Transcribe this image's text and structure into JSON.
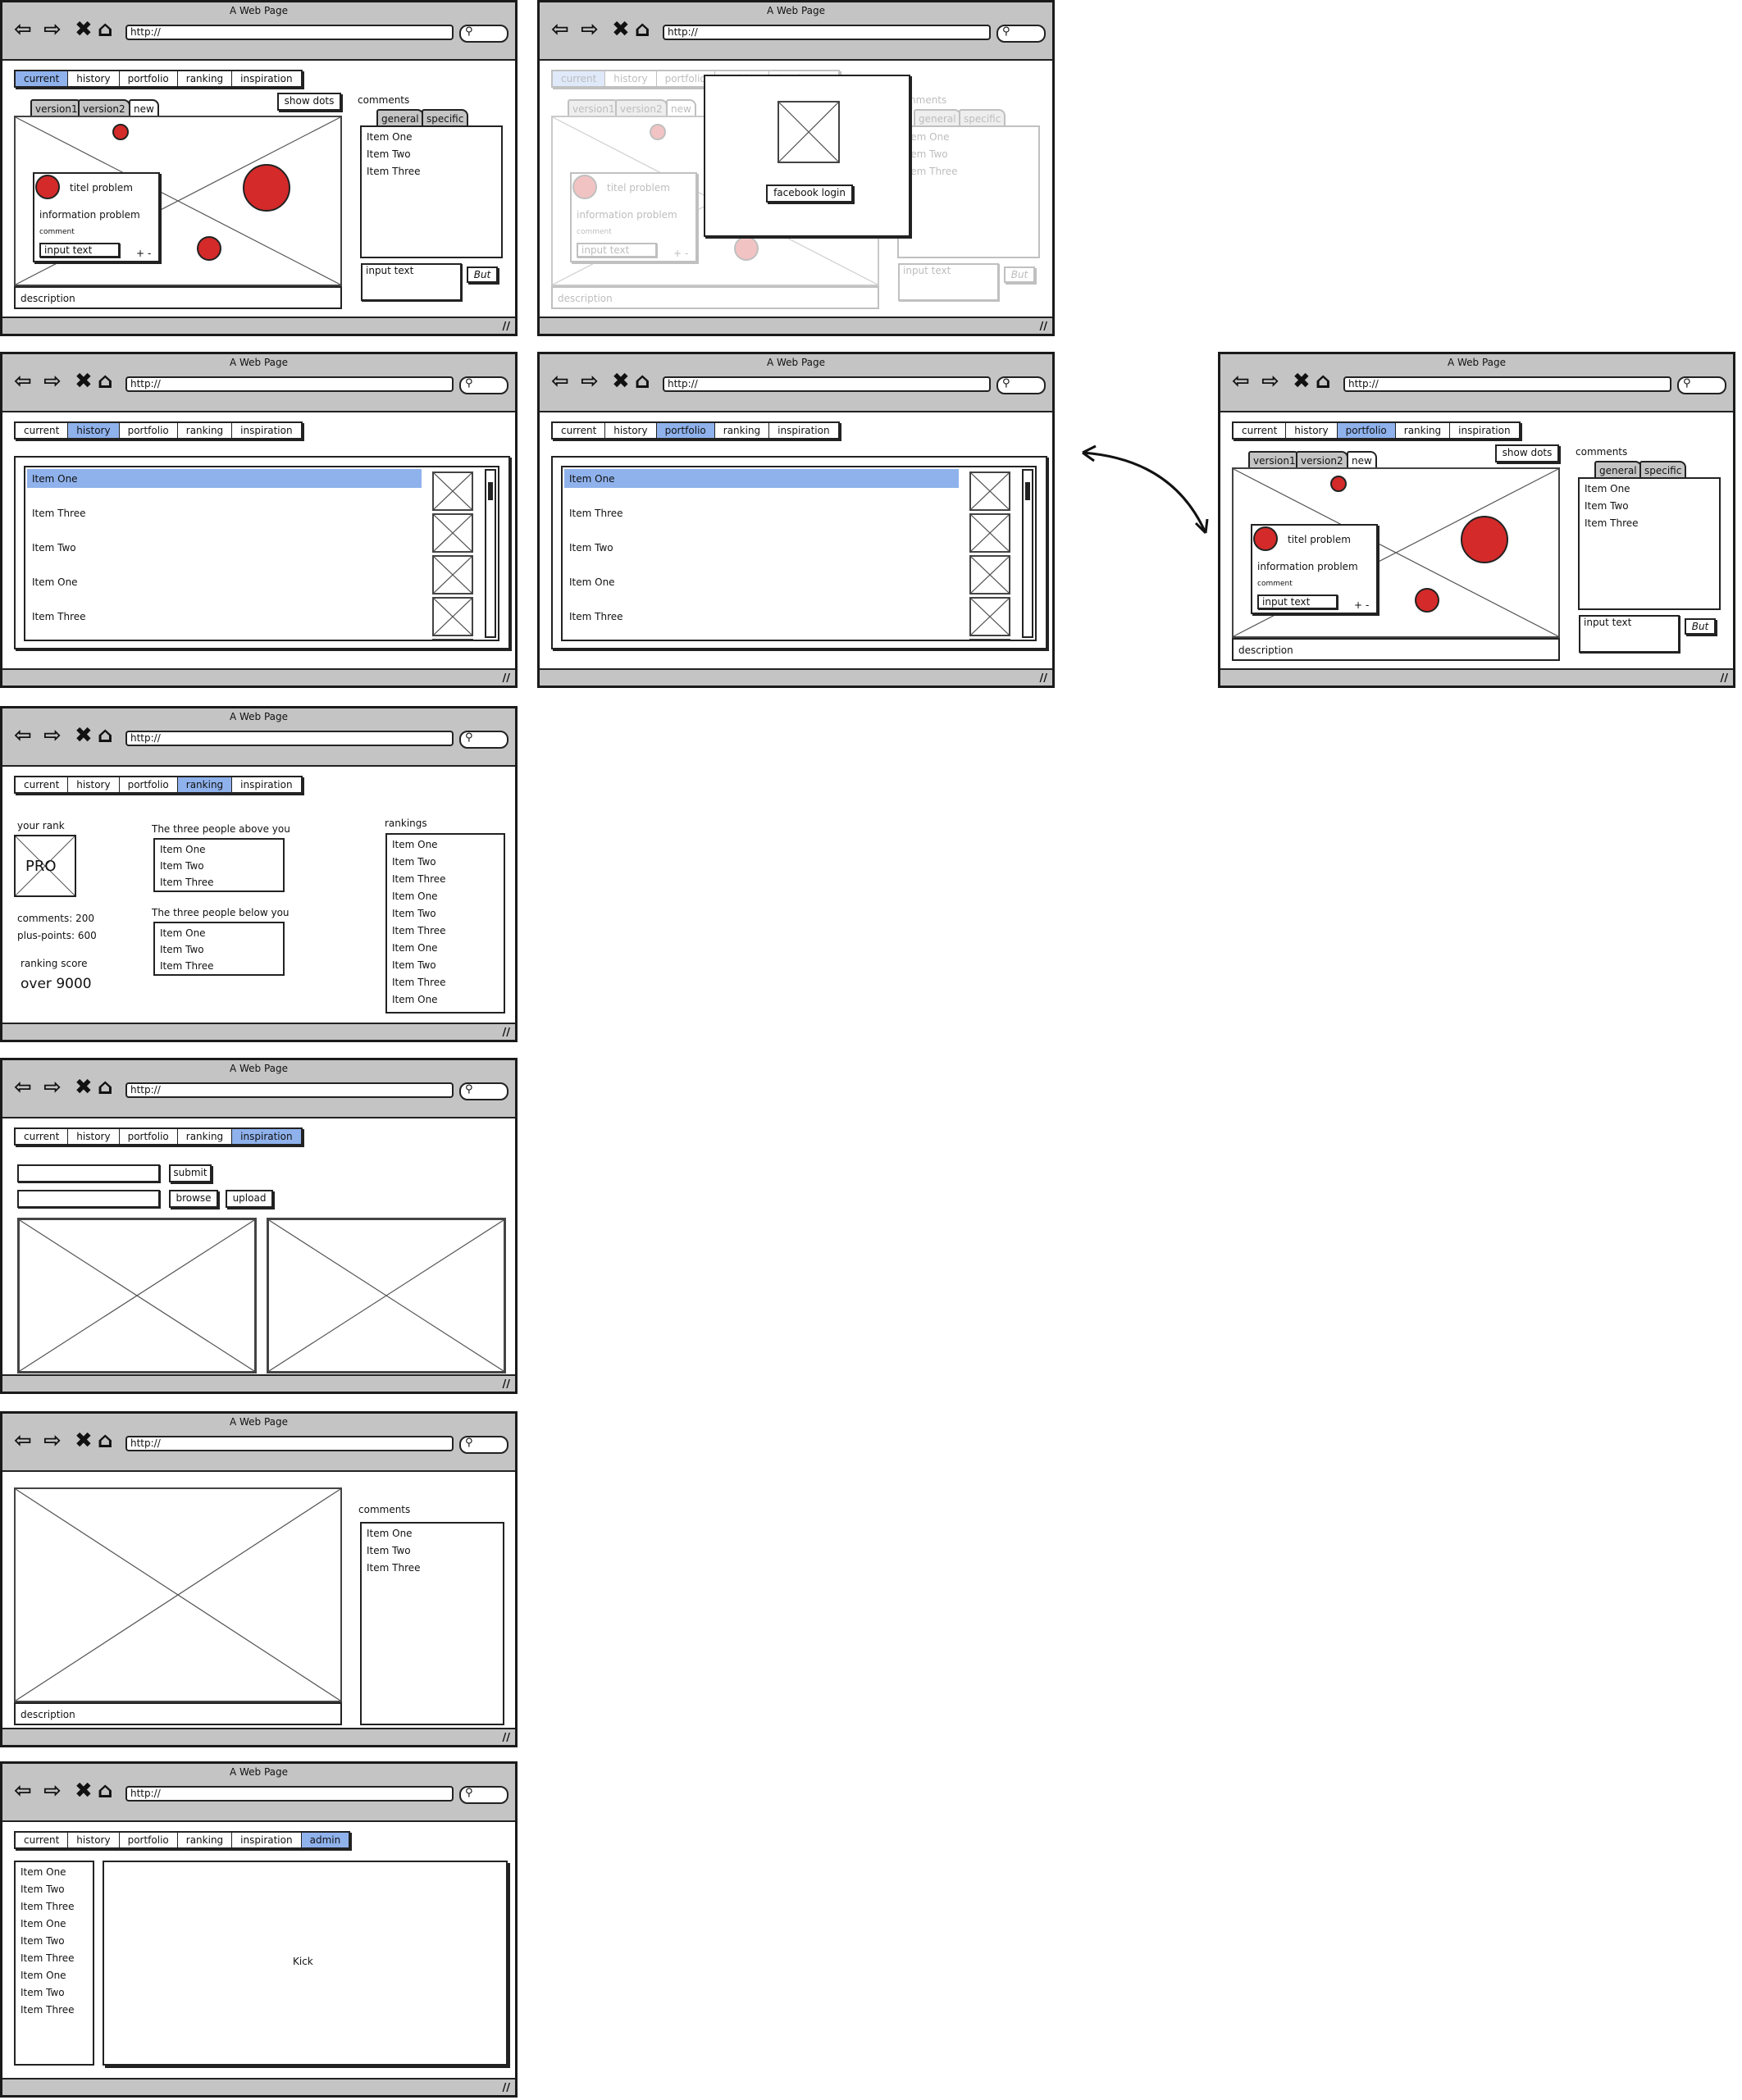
{
  "browser": {
    "title": "A Web Page",
    "url": "http://",
    "nav_icons": [
      "back-arrow-icon",
      "forward-arrow-icon",
      "stop-x-icon",
      "home-icon"
    ],
    "search_icon": "search-icon",
    "resize_grip": "//"
  },
  "nav_tabs": [
    "current",
    "history",
    "portfolio",
    "ranking",
    "inspiration"
  ],
  "admin_tabs": [
    "current",
    "history",
    "portfolio",
    "ranking",
    "inspiration",
    "admin"
  ],
  "accent_color": "#8fb2ec",
  "dot_color": "#d42a2a",
  "editor": {
    "version_tabs": [
      "version1",
      "version2",
      "new"
    ],
    "show_dots": "show dots",
    "popup_title": "titel problem",
    "popup_info": "information problem",
    "popup_comment_label": "comment",
    "popup_input": "input text",
    "popup_plus": "+",
    "popup_minus": "-",
    "description": "description",
    "comments_label": "comments",
    "comment_tabs": [
      "general",
      "specific"
    ],
    "comments": [
      "Item One",
      "Item Two",
      "Item Three"
    ],
    "comment_input": "input text",
    "comment_button": "But"
  },
  "login": {
    "button": "facebook login"
  },
  "history_list": [
    "Item One",
    "Item Three",
    "Item Two",
    "Item One",
    "Item Three"
  ],
  "ranking": {
    "your_rank": "your rank",
    "badge": "PRO",
    "comments": "comments: 200",
    "plus_points": "plus-points: 600",
    "score_label": "ranking score",
    "score": "over 9000",
    "above_label": "The three people above you",
    "above": [
      "Item One",
      "Item Two",
      "Item Three"
    ],
    "below_label": "The three people below you",
    "below": [
      "Item One",
      "Item Two",
      "Item Three"
    ],
    "rankings_label": "rankings",
    "rankings": [
      "Item One",
      "Item Two",
      "Item Three",
      "Item One",
      "Item Two",
      "Item Three",
      "Item One",
      "Item Two",
      "Item Three",
      "Item One"
    ]
  },
  "inspiration": {
    "submit": "submit",
    "browse": "browse",
    "upload": "upload"
  },
  "detail": {
    "description": "description",
    "comments_label": "comments",
    "comments": [
      "Item One",
      "Item Two",
      "Item Three"
    ]
  },
  "admin": {
    "list": [
      "Item One",
      "Item Two",
      "Item Three",
      "Item One",
      "Item Two",
      "Item Three",
      "Item One",
      "Item Two",
      "Item Three"
    ],
    "panel_text": "Kick"
  }
}
